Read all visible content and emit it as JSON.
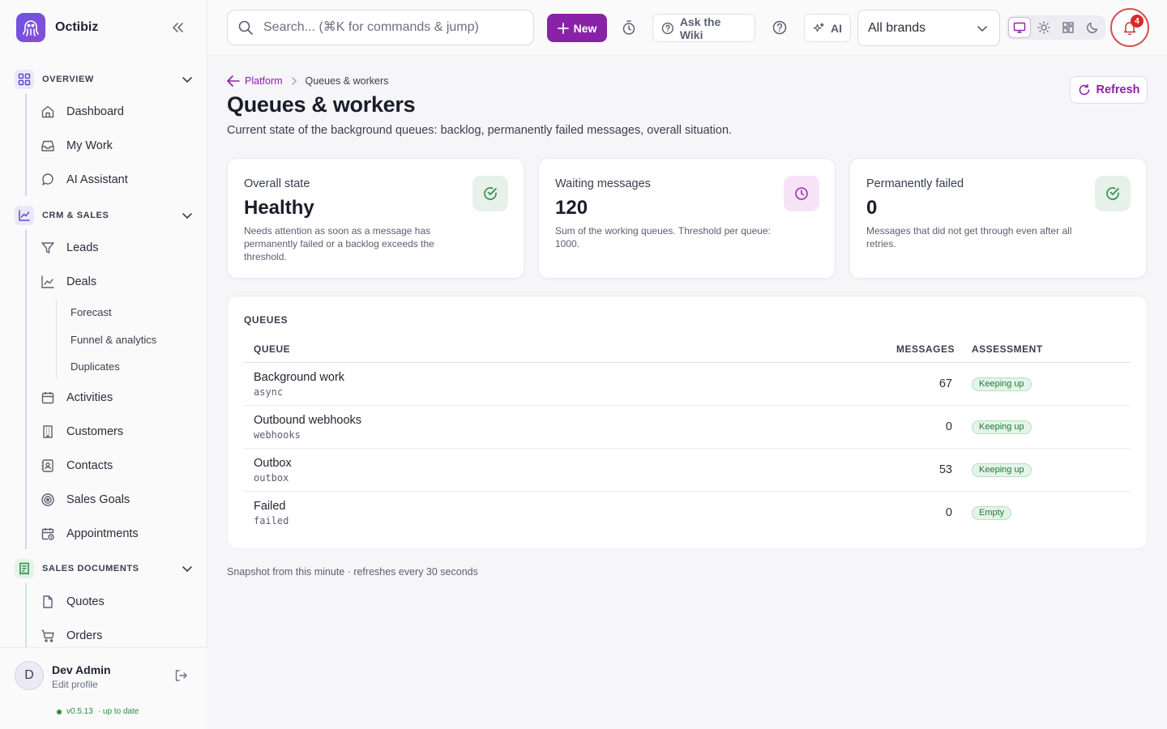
{
  "app": {
    "name": "Octibiz"
  },
  "search": {
    "placeholder": "Search... (⌘K for commands & jump)"
  },
  "topbar": {
    "new_label": "New",
    "wiki_label": "Ask the Wiki",
    "ai_label": "AI",
    "brand_select": "All brands",
    "notifications_count": "4"
  },
  "sidebar": {
    "sections": [
      {
        "label": "OVERVIEW",
        "items": [
          "Dashboard",
          "My Work",
          "AI Assistant"
        ]
      },
      {
        "label": "CRM & SALES",
        "items": [
          "Leads",
          "Deals",
          "Activities",
          "Customers",
          "Contacts",
          "Sales Goals",
          "Appointments"
        ],
        "deal_subitems": [
          "Forecast",
          "Funnel & analytics",
          "Duplicates"
        ]
      },
      {
        "label": "SALES DOCUMENTS",
        "items": [
          "Quotes",
          "Orders"
        ]
      }
    ]
  },
  "user": {
    "initial": "D",
    "name": "Dev Admin",
    "edit": "Edit profile",
    "version": "v0.5.13",
    "version_status": "· up to date"
  },
  "breadcrumb": {
    "parent": "Platform",
    "current": "Queues & workers"
  },
  "page": {
    "title": "Queues & workers",
    "description": "Current state of the background queues: backlog, permanently failed messages, overall situation.",
    "refresh_label": "Refresh"
  },
  "cards": [
    {
      "label": "Overall state",
      "value": "Healthy",
      "note": "Needs attention as soon as a message has permanently failed or a backlog exceeds the threshold."
    },
    {
      "label": "Waiting messages",
      "value": "120",
      "note": "Sum of the working queues. Threshold per queue: 1000."
    },
    {
      "label": "Permanently failed",
      "value": "0",
      "note": "Messages that did not get through even after all retries."
    }
  ],
  "queues": {
    "title": "QUEUES",
    "columns": {
      "queue": "QUEUE",
      "messages": "MESSAGES",
      "assessment": "ASSESSMENT"
    },
    "rows": [
      {
        "name": "Background work",
        "code": "async",
        "messages": "67",
        "assessment": "Keeping up"
      },
      {
        "name": "Outbound webhooks",
        "code": "webhooks",
        "messages": "0",
        "assessment": "Keeping up"
      },
      {
        "name": "Outbox",
        "code": "outbox",
        "messages": "53",
        "assessment": "Keeping up"
      },
      {
        "name": "Failed",
        "code": "failed",
        "messages": "0",
        "assessment": "Empty"
      }
    ]
  },
  "footnote": "Snapshot from this minute · refreshes every 30 seconds",
  "colors": {
    "accent": "#8a22a7",
    "ok": "#2f8a48",
    "alert": "#d62c2c"
  }
}
